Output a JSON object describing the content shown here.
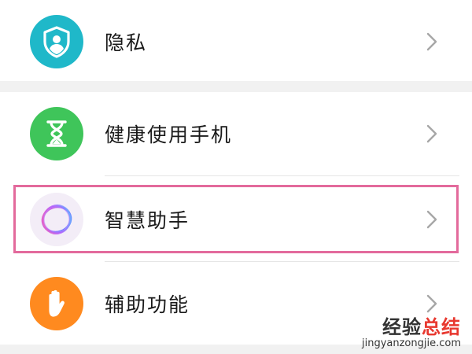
{
  "settings": {
    "items": [
      {
        "label": "隐私",
        "icon": "shield-person-icon",
        "icon_color": "#1fb8c9"
      },
      {
        "label": "健康使用手机",
        "icon": "hourglass-icon",
        "icon_color": "#3fc55a"
      },
      {
        "label": "智慧助手",
        "icon": "ring-assistant-icon",
        "icon_color": "#f3edf7"
      },
      {
        "label": "辅助功能",
        "icon": "hand-icon",
        "icon_color": "#ff8a1f"
      }
    ],
    "highlight_color": "#e36a9c",
    "section_gap_color": "#f1f1f1"
  },
  "watermark": {
    "title_part1": "经验",
    "title_part2": "总结",
    "url": "jingyanzongjie.com"
  }
}
